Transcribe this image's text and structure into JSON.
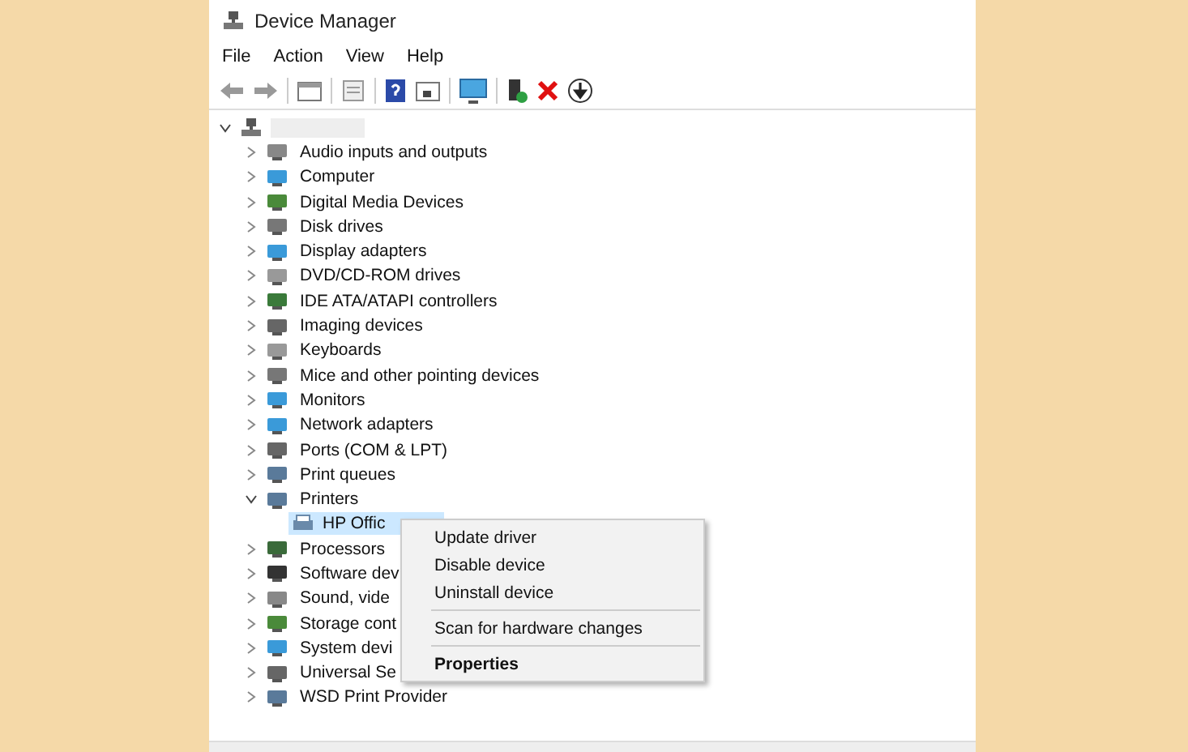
{
  "window": {
    "title": "Device Manager"
  },
  "menu": [
    "File",
    "Action",
    "View",
    "Help"
  ],
  "tree": {
    "expanded": true,
    "children": [
      {
        "label": "Audio inputs and outputs",
        "expanded": false,
        "selected": false
      },
      {
        "label": "Computer",
        "expanded": false,
        "selected": false
      },
      {
        "label": "Digital Media Devices",
        "expanded": false,
        "selected": false
      },
      {
        "label": "Disk drives",
        "expanded": false,
        "selected": false
      },
      {
        "label": "Display adapters",
        "expanded": false,
        "selected": false
      },
      {
        "label": "DVD/CD-ROM drives",
        "expanded": false,
        "selected": false
      },
      {
        "label": "IDE ATA/ATAPI controllers",
        "expanded": false,
        "selected": false
      },
      {
        "label": "Imaging devices",
        "expanded": false,
        "selected": false
      },
      {
        "label": "Keyboards",
        "expanded": false,
        "selected": false
      },
      {
        "label": "Mice and other pointing devices",
        "expanded": false,
        "selected": false
      },
      {
        "label": "Monitors",
        "expanded": false,
        "selected": false
      },
      {
        "label": "Network adapters",
        "expanded": false,
        "selected": false
      },
      {
        "label": "Ports (COM & LPT)",
        "expanded": false,
        "selected": false
      },
      {
        "label": "Print queues",
        "expanded": false,
        "selected": false
      },
      {
        "label": "Printers",
        "expanded": true,
        "selected": false,
        "children": [
          {
            "label": "HP Offic",
            "selected": true
          }
        ]
      },
      {
        "label": "Processors",
        "expanded": false,
        "selected": false
      },
      {
        "label": "Software dev",
        "expanded": false,
        "selected": false
      },
      {
        "label": "Sound, vide",
        "expanded": false,
        "selected": false
      },
      {
        "label": "Storage cont",
        "expanded": false,
        "selected": false
      },
      {
        "label": "System devi",
        "expanded": false,
        "selected": false
      },
      {
        "label": "Universal Se",
        "expanded": false,
        "selected": false
      },
      {
        "label": "WSD Print Provider",
        "expanded": false,
        "selected": false
      }
    ]
  },
  "context_menu": [
    {
      "kind": "item",
      "label": "Update driver",
      "default": false
    },
    {
      "kind": "item",
      "label": "Disable device",
      "default": false
    },
    {
      "kind": "item",
      "label": "Uninstall device",
      "default": false
    },
    {
      "kind": "separator"
    },
    {
      "kind": "item",
      "label": "Scan for hardware changes",
      "default": false
    },
    {
      "kind": "separator"
    },
    {
      "kind": "item",
      "label": "Properties",
      "default": true
    }
  ]
}
